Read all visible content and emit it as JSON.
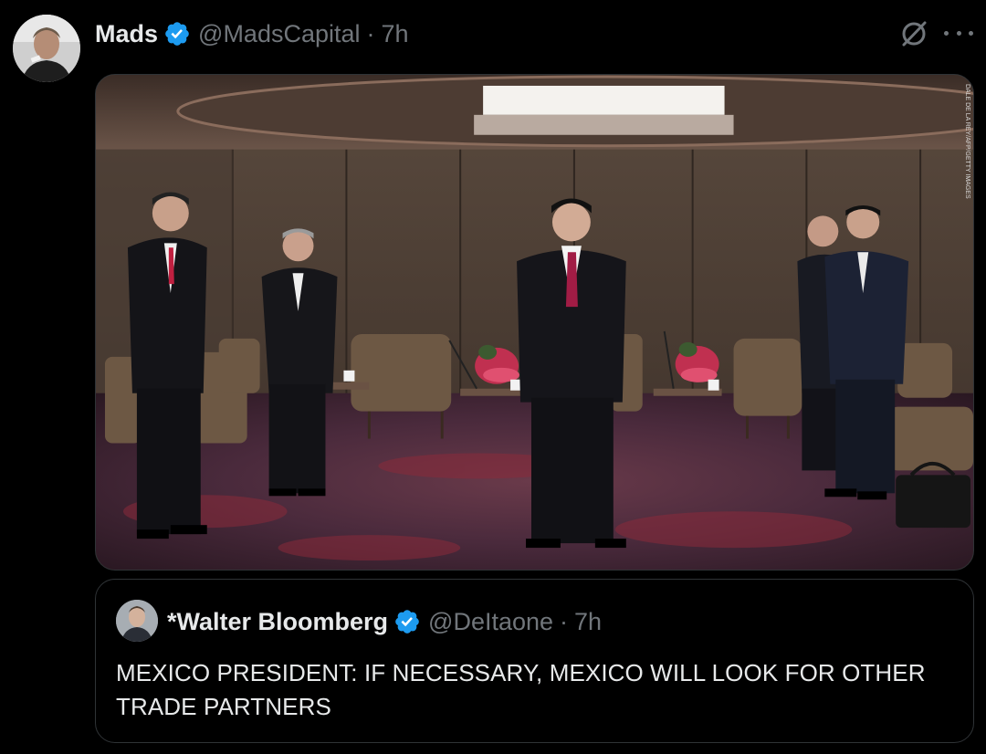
{
  "tweet": {
    "author_name": "Mads",
    "author_handle": "@MadsCapital",
    "separator": "·",
    "time": "7h",
    "avatar_icon": "user-avatar",
    "verified_icon": "verified-badge-icon",
    "grok_icon": "grok-icon",
    "more_icon": "more-options-icon",
    "image_watermark": "DALE DE LA REY/AFP/GETTY IMAGES"
  },
  "quote": {
    "author_name": "*Walter Bloomberg",
    "author_handle": "@DeItaone",
    "separator": "·",
    "time": "7h",
    "text": "MEXICO PRESIDENT: IF NECESSARY, MEXICO WILL LOOK FOR OTHER TRADE PARTNERS"
  },
  "colors": {
    "background": "#000000",
    "text_primary": "#e7e9ea",
    "text_secondary": "#71767b",
    "verified_blue": "#1d9bf0",
    "border": "#2f3336"
  }
}
